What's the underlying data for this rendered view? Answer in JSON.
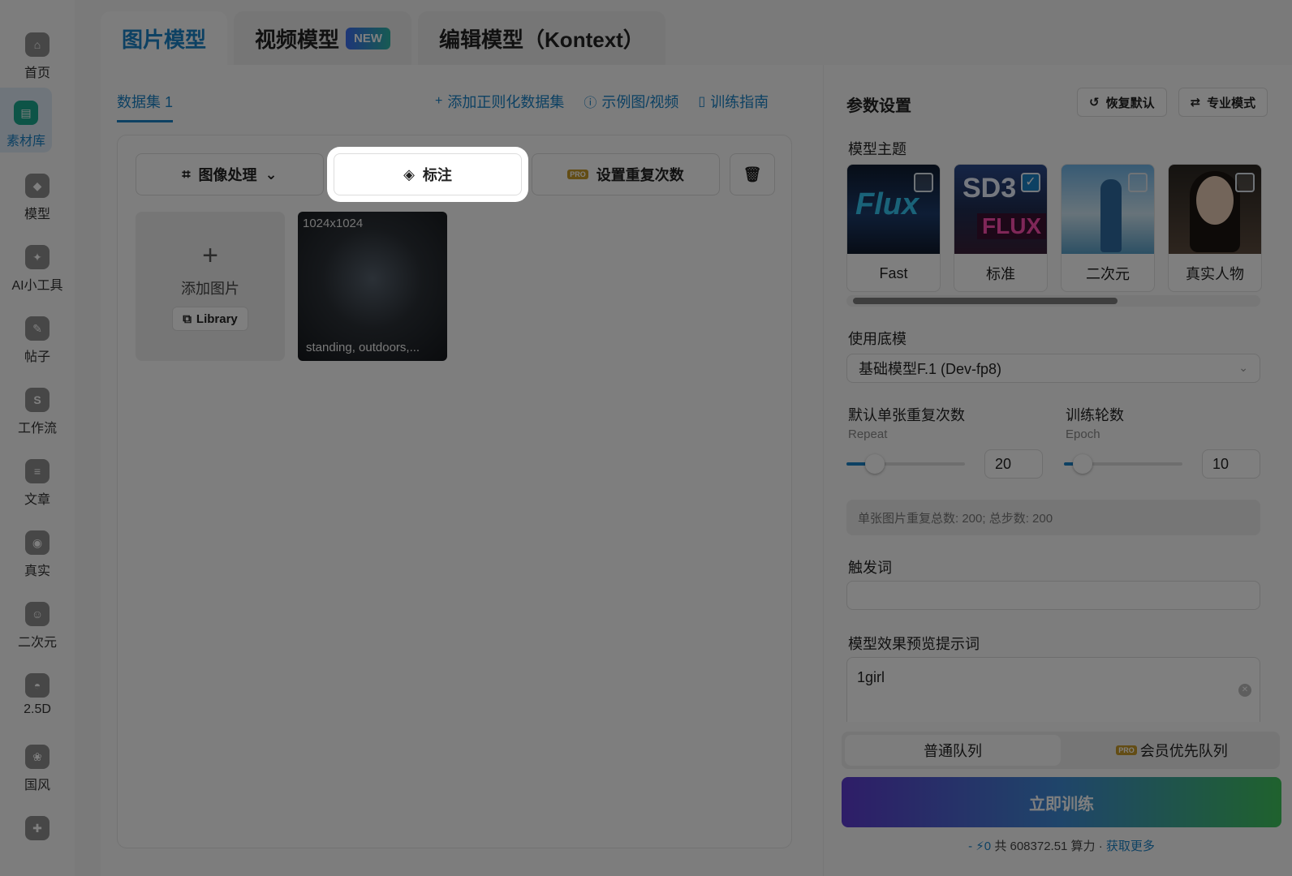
{
  "sidebar": {
    "items": [
      {
        "label": "首页",
        "icon": "home-icon"
      },
      {
        "label": "素材库",
        "icon": "library-icon",
        "active": true
      },
      {
        "label": "模型",
        "icon": "cube-icon"
      },
      {
        "label": "AI小工具",
        "icon": "tool-icon"
      },
      {
        "label": "帖子",
        "icon": "post-icon"
      },
      {
        "label": "工作流",
        "icon": "workflow-icon"
      },
      {
        "label": "文章",
        "icon": "article-icon"
      },
      {
        "label": "真实",
        "icon": "camera-icon"
      },
      {
        "label": "二次元",
        "icon": "anime-icon"
      },
      {
        "label": "2.5D",
        "icon": "ufo-icon"
      },
      {
        "label": "国风",
        "icon": "fan-icon"
      },
      {
        "label": "",
        "icon": "gamepad-icon"
      }
    ]
  },
  "tabs": {
    "image": "图片模型",
    "video": "视频模型",
    "video_badge": "NEW",
    "edit": "编辑模型（Kontext）"
  },
  "dataset": {
    "tab": "数据集 1",
    "add_reg": "添加正则化数据集",
    "examples": "示例图/视频",
    "guide": "训练指南"
  },
  "toolbar": {
    "image_process": "图像处理",
    "annotate": "标注",
    "set_repeat": "设置重复次数"
  },
  "add_card": {
    "plus": "+",
    "text": "添加图片",
    "library": "Library"
  },
  "image_card": {
    "size": "1024x1024",
    "caption": "standing, outdoors,..."
  },
  "params": {
    "title": "参数设置",
    "reset": "恢复默认",
    "pro_mode": "专业模式",
    "theme_label": "模型主题",
    "themes": [
      {
        "name": "Fast",
        "checked": false
      },
      {
        "name": "标准",
        "checked": true
      },
      {
        "name": "二次元",
        "checked": false
      },
      {
        "name": "真实人物",
        "checked": false
      }
    ],
    "theme_art": {
      "fast": "Flux",
      "sd3_top": "SD3",
      "sd3_bottom": "FLUX"
    },
    "base_label": "使用底模",
    "base_value": "基础模型F.1 (Dev-fp8)",
    "repeat_label": "默认单张重复次数",
    "repeat_sub": "Repeat",
    "repeat_value": "20",
    "repeat_level": 0.24,
    "epoch_label": "训练轮数",
    "epoch_sub": "Epoch",
    "epoch_value": "10",
    "epoch_level": 0.16,
    "summary": "单张图片重复总数: 200;  总步数: 200",
    "trigger_label": "触发词",
    "trigger_value": "",
    "prompt_label": "模型效果预览提示词",
    "prompt_value": "1girl"
  },
  "queue": {
    "normal": "普通队列",
    "vip": "会员优先队列"
  },
  "train": {
    "button": "立即训练",
    "cost_prefix": "- ⚡0",
    "cost_total": " 共 608372.51 算力 · ",
    "more": "获取更多"
  },
  "colors": {
    "accent": "#1b82c6",
    "train_gradient_start": "#5d3bd0",
    "train_gradient_end": "#3fc45c"
  }
}
